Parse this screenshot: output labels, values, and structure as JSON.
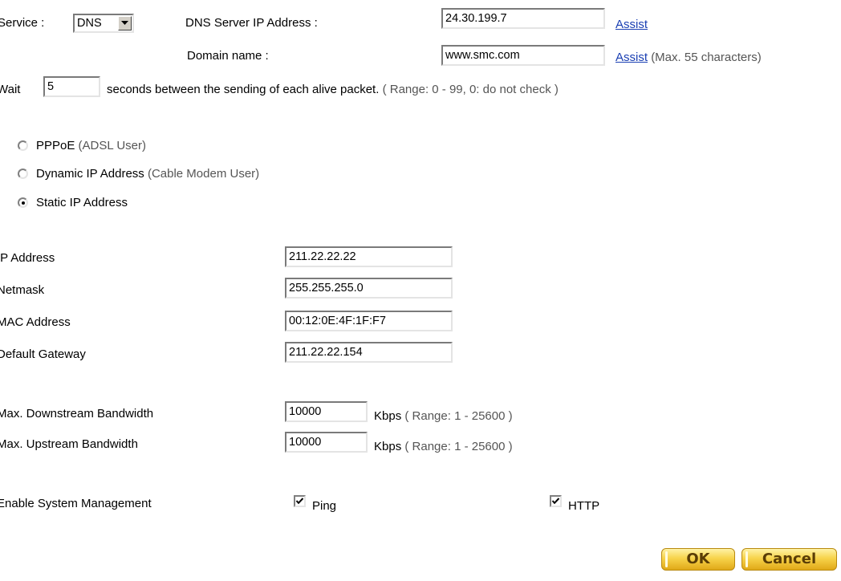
{
  "service": {
    "label": "Service :",
    "selected": "DNS",
    "dns_server_label": "DNS Server IP Address :",
    "dns_server_value": "24.30.199.7",
    "assist_label": "Assist",
    "domain_label": "Domain name :",
    "domain_value": "www.smc.com",
    "domain_assist_label": "Assist",
    "domain_hint": "(Max. 55 characters)"
  },
  "wait": {
    "prefix": "Wait",
    "value": "5",
    "text": "seconds between the sending of each alive packet.",
    "hint": "( Range: 0 - 99, 0: do not check )"
  },
  "connection": {
    "options": [
      {
        "label": "PPPoE",
        "hint": "(ADSL User)",
        "selected": false
      },
      {
        "label": "Dynamic IP Address",
        "hint": "(Cable Modem User)",
        "selected": false
      },
      {
        "label": "Static IP Address",
        "hint": "",
        "selected": true
      }
    ]
  },
  "static": {
    "ip_label": "IP Address",
    "ip_value": "211.22.22.22",
    "netmask_label": "Netmask",
    "netmask_value": "255.255.255.0",
    "mac_label": "MAC Address",
    "mac_value": "00:12:0E:4F:1F:F7",
    "gateway_label": "Default Gateway",
    "gateway_value": "211.22.22.154"
  },
  "bandwidth": {
    "down_label": "Max. Downstream Bandwidth",
    "down_value": "10000",
    "up_label": "Max. Upstream Bandwidth",
    "up_value": "10000",
    "unit": "Kbps",
    "range_hint": "( Range: 1 - 25600 )"
  },
  "management": {
    "label": "Enable System Management",
    "ping_label": "Ping",
    "ping_checked": true,
    "http_label": "HTTP",
    "http_checked": true
  },
  "actions": {
    "ok_label": "OK",
    "cancel_label": "Cancel"
  }
}
